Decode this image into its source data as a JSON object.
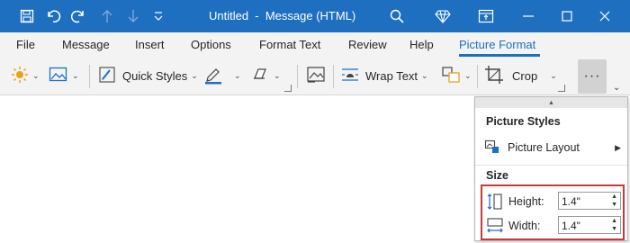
{
  "window": {
    "title": "Untitled  -  Message (HTML)"
  },
  "tabs": [
    {
      "label": "File"
    },
    {
      "label": "Message"
    },
    {
      "label": "Insert"
    },
    {
      "label": "Options"
    },
    {
      "label": "Format Text"
    },
    {
      "label": "Review"
    },
    {
      "label": "Help"
    },
    {
      "label": "Picture Format",
      "active": true
    }
  ],
  "ribbon": {
    "quick_styles_label": "Quick Styles",
    "wrap_text_label": "Wrap Text",
    "crop_label": "Crop",
    "more_label": "···"
  },
  "panel": {
    "picture_styles_heading": "Picture Styles",
    "picture_layout_label": "Picture Layout",
    "size_heading": "Size",
    "height_label": "Height:",
    "height_value": "1.4\"",
    "width_label": "Width:",
    "width_value": "1.4\""
  },
  "colors": {
    "accent": "#1f6fc1",
    "highlight_border": "#c83a3a",
    "sun": "#e8a317"
  }
}
